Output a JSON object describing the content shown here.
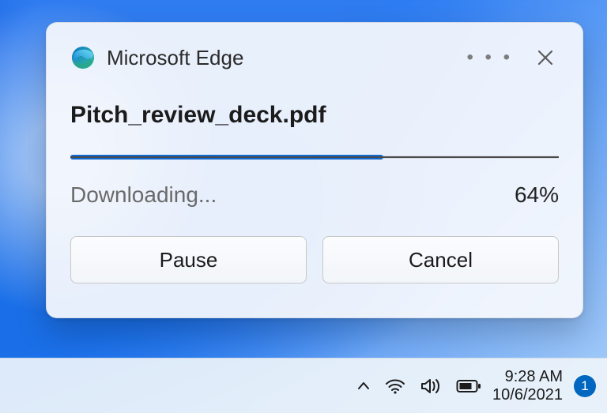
{
  "toast": {
    "app_name": "Microsoft Edge",
    "filename": "Pitch_review_deck.pdf",
    "status": "Downloading...",
    "percent_text": "64%",
    "percent_value": 64,
    "pause_label": "Pause",
    "cancel_label": "Cancel"
  },
  "taskbar": {
    "time": "9:28 AM",
    "date": "10/6/2021",
    "notification_count": "1"
  }
}
